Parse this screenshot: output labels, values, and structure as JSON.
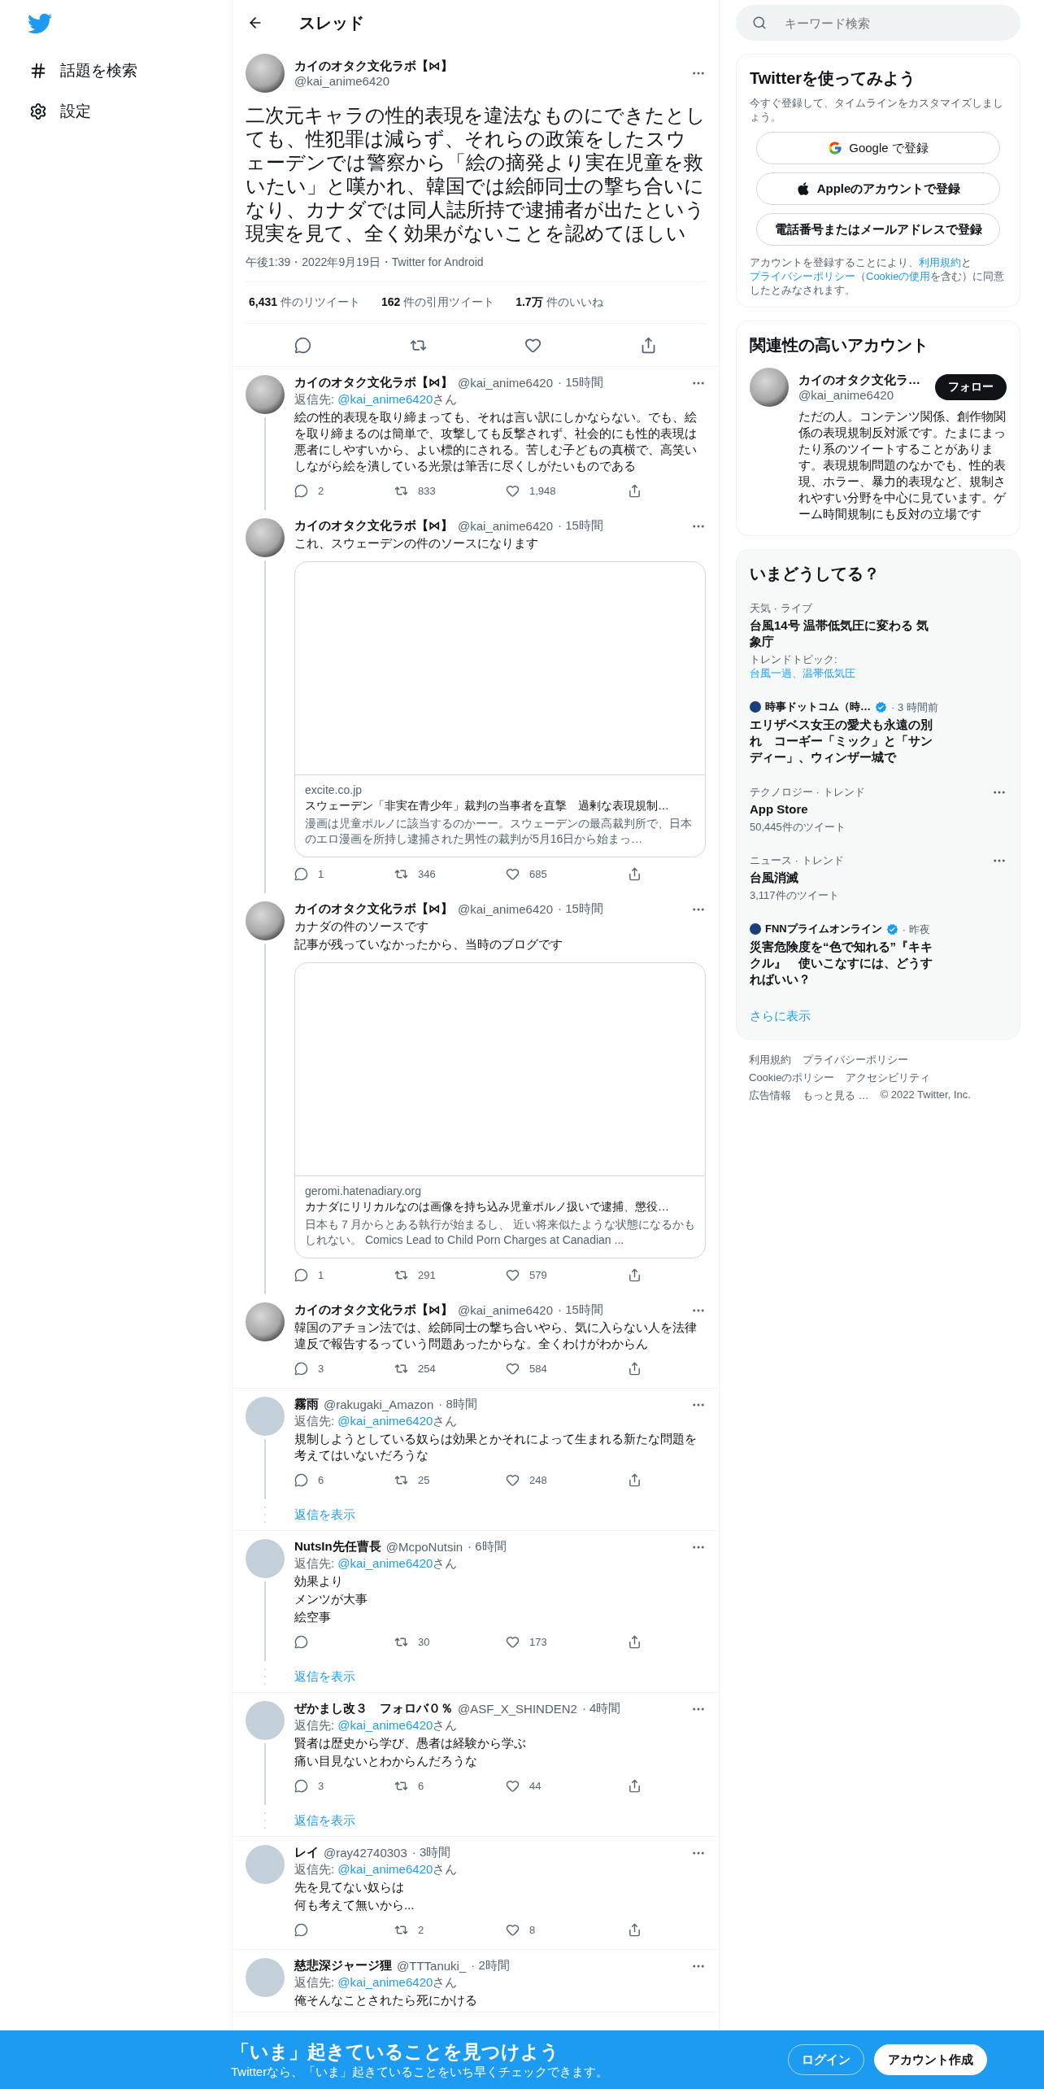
{
  "nav": {
    "items": [
      {
        "kind": "explore",
        "label": "話題を検索"
      },
      {
        "kind": "settings",
        "label": "設定"
      }
    ]
  },
  "header": {
    "title": "スレッド"
  },
  "main_tweet": {
    "name": "カイのオタク文化ラボ【⋈】",
    "handle": "@kai_anime6420",
    "text": "二次元キャラの性的表現を違法なものにできたとしても、性犯罪は減らず、それらの政策をしたスウェーデンでは警察から「絵の摘発より実在児童を救いたい」と嘆かれ、韓国では絵師同士の撃ち合いになり、カナダでは同人誌所持で逮捕者が出たという現実を見て、全く効果がないことを認めてほしい",
    "meta": "午後1:39・2022年9月19日・Twitter for Android",
    "stats": [
      "**6,431** 件のリツイート",
      "**162** 件の引用ツイート",
      "**1.7万** 件のいいね"
    ]
  },
  "replies": [
    {
      "kind": "photo",
      "name": "カイのオタク文化ラボ【⋈】",
      "handle": "@kai_anime6420",
      "time": "· 15時間",
      "reply_to": {
        "label": "返信先: ",
        "handle": "@kai_anime6420",
        "suffix": "さん"
      },
      "text": "絵の性的表現を取り締まっても、それは言い訳にしかならない。でも、絵を取り締まるのは簡単で、攻撃しても反撃されず、社会的にも性的表現は悪者にしやすいから、よい標的にされる。苦しむ子どもの真横で、高笑いしながら絵を潰している光景は筆舌に尽くしがたいものである",
      "thread_line": true,
      "counts": {
        "reply": "2",
        "retweet": "833",
        "like": "1,948"
      }
    },
    {
      "kind": "photo",
      "name": "カイのオタク文化ラボ【⋈】",
      "handle": "@kai_anime6420",
      "time": "· 15時間",
      "text": "これ、スウェーデンの件のソースになります",
      "card": {
        "domain": "excite.co.jp",
        "title": "スウェーデン「非実在青少年」裁判の当事者を直撃　過剰な表現規制…",
        "description": "漫画は児童ポルノに該当するのかーー。スウェーデンの最高裁判所で、日本のエロ漫画を所持し逮捕された男性の裁判が5月16日から始まっ…"
      },
      "thread_line": true,
      "counts": {
        "reply": "1",
        "retweet": "346",
        "like": "685"
      }
    },
    {
      "kind": "photo",
      "name": "カイのオタク文化ラボ【⋈】",
      "handle": "@kai_anime6420",
      "time": "· 15時間",
      "lines": [
        "カナダの件のソースです",
        "記事が残っていなかったから、当時のブログです"
      ],
      "card": {
        "domain": "geromi.hatenadiary.org",
        "title": "カナダにリリカルなのは画像を持ち込み児童ポルノ扱いで逮捕、懲役…",
        "description": "日本も７月からとある執行が始まるし、 近い将来似たような状態になるかもしれない。 Comics Lead to Child Porn Charges at Canadian ..."
      },
      "thread_line": true,
      "counts": {
        "reply": "1",
        "retweet": "291",
        "like": "579"
      }
    },
    {
      "kind": "photo",
      "name": "カイのオタク文化ラボ【⋈】",
      "handle": "@kai_anime6420",
      "time": "· 15時間",
      "text": "韓国のアチョン法では、絵師同士の撃ち合いやら、気に入らない人を法律違反で報告するっていう問題あったからな。全くわけがわからん",
      "thread_line": false,
      "counts": {
        "reply": "3",
        "retweet": "254",
        "like": "584"
      }
    },
    {
      "kind": "default",
      "name": "霧雨",
      "handle": "@rakugaki_Amazon",
      "time": "· 8時間",
      "reply_to": {
        "label": "返信先: ",
        "handle": "@kai_anime6420",
        "suffix": "さん"
      },
      "text": "規制しようとしている奴らは効果とかそれによって生まれる新たな問題を考えてはいないだろうな",
      "thread_line": true,
      "counts": {
        "reply": "6",
        "retweet": "25",
        "like": "248"
      },
      "show_replies": "返信を表示"
    },
    {
      "kind": "default",
      "name": "NutsIn先任曹長",
      "handle": "@McpoNutsin",
      "time": "· 6時間",
      "reply_to": {
        "label": "返信先: ",
        "handle": "@kai_anime6420",
        "suffix": "さん"
      },
      "lines": [
        "効果より",
        "メンツが大事",
        "絵空事"
      ],
      "thread_line": true,
      "counts": {
        "retweet": "30",
        "like": "173"
      },
      "show_replies": "返信を表示"
    },
    {
      "kind": "default",
      "name": "ぜかまし改３　フォロバ０％",
      "handle": "@ASF_X_SHINDEN2",
      "time": "· 4時間",
      "reply_to": {
        "label": "返信先: ",
        "handle": "@kai_anime6420",
        "suffix": "さん"
      },
      "lines": [
        "賢者は歴史から学び、愚者は経験から学ぶ",
        "痛い目見ないとわからんだろうな"
      ],
      "thread_line": true,
      "counts": {
        "reply": "3",
        "retweet": "6",
        "like": "44"
      },
      "show_replies": "返信を表示"
    },
    {
      "kind": "default",
      "name": "レイ",
      "handle": "@ray42740303",
      "time": "· 3時間",
      "reply_to": {
        "label": "返信先: ",
        "handle": "@kai_anime6420",
        "suffix": "さん"
      },
      "lines": [
        "先を見てない奴らは",
        "何も考えて無いから..."
      ],
      "thread_line": false,
      "counts": {
        "retweet": "2",
        "like": "8"
      }
    },
    {
      "kind": "default",
      "name": "慈悲深ジャージ狸",
      "handle": "@TTTanuki_",
      "time": "· 2時間",
      "reply_to": {
        "label": "返信先: ",
        "handle": "@kai_anime6420",
        "suffix": "さん"
      },
      "text": "俺そんなことされたら死にかける",
      "thread_line": false
    }
  ],
  "search": {
    "placeholder": "キーワード検索"
  },
  "signup": {
    "title": "Twitterを使ってみよう",
    "subtitle": "今すぐ登録して、タイムラインをカスタマイズしましょう。",
    "buttons": [
      {
        "kind": "google",
        "label": "Google で登録"
      },
      {
        "kind": "apple",
        "label": "Appleのアカウントで登録"
      },
      {
        "kind": "plain",
        "label": "電話番号またはメールアドレスで登録"
      }
    ],
    "legal": [
      {
        "kind": "text",
        "text": "アカウントを登録することにより、"
      },
      {
        "kind": "link",
        "text": "利用規約"
      },
      {
        "kind": "text",
        "text": "と"
      },
      {
        "kind": "link",
        "text": "プライバシーポリシー"
      },
      {
        "kind": "text",
        "text": "（"
      },
      {
        "kind": "link",
        "text": "Cookieの使用"
      },
      {
        "kind": "text",
        "text": "を含む）に同意したとみなされます。"
      }
    ]
  },
  "related": {
    "title": "関連性の高いアカウント",
    "name": "カイのオタク文化ラ…",
    "handle": "@kai_anime6420",
    "button": "フォロー",
    "bio": "ただの人。コンテンツ関係、創作物関係の表現規制反対派です。たまにまったり系のツイートすることがあります。表現規制問題のなかでも、性的表現、ホラー、暴力的表現など、規制されやすい分野を中心に見ています。ゲーム時間規制にも反対の立場です"
  },
  "trends": {
    "title": "いまどうしてる？",
    "more": "さらに表示",
    "items": [
      {
        "kind": "event",
        "category": "天気 · ライブ",
        "title": "台風14号 温帯低気圧に変わる 気象庁",
        "topic_label": "トレンドトピック: ",
        "topic": "台風一過、温帯低気圧"
      },
      {
        "kind": "news",
        "source": "時事ドットコム（時…",
        "verified": true,
        "time": "· 3 時間前",
        "title": "エリザベス女王の愛犬も永遠の別れ　コーギー「ミック」と「サンディー」、ウィンザー城で"
      },
      {
        "kind": "trend",
        "category": "テクノロジー · トレンド",
        "title": "App Store",
        "count": "50,445件のツイート"
      },
      {
        "kind": "trend",
        "category": "ニュース · トレンド",
        "title": "台風消滅",
        "count": "3,117件のツイート"
      },
      {
        "kind": "news",
        "source": "FNNプライムオンライン",
        "verified": true,
        "time": "· 昨夜",
        "title": "災害危険度を“色で知れる”『キキクル』　使いこなすには、どうすればいい？"
      }
    ]
  },
  "footer": [
    "利用規約",
    "プライバシーポリシー",
    "Cookieのポリシー",
    "アクセシビリティ",
    "広告情報",
    "もっと見る …",
    "© 2022 Twitter, Inc."
  ],
  "banner": {
    "title": "「いま」起きていることを見つけよう",
    "subtitle": "Twitterなら、「いま」起きていることをいち早くチェックできます。",
    "login": "ログイン",
    "signup": "アカウント作成"
  }
}
